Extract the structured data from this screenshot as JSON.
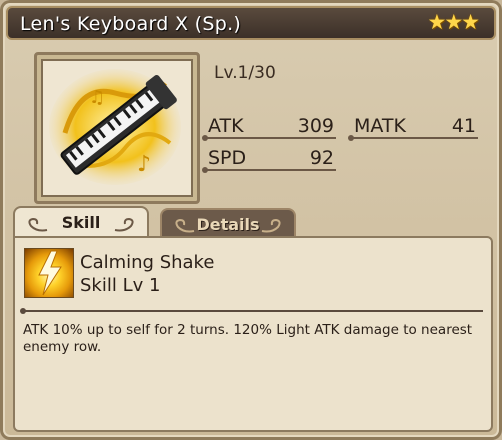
{
  "item": {
    "name": "Len's Keyboard X (Sp.)",
    "rarity_stars": "★★★",
    "level": "Lv.1/30"
  },
  "stats": {
    "atk_label": "ATK",
    "atk_value": "309",
    "matk_label": "MATK",
    "matk_value": "41",
    "spd_label": "SPD",
    "spd_value": "92"
  },
  "tabs": {
    "skill_label": "Skill",
    "details_label": "Details"
  },
  "skill": {
    "name": "Calming Shake",
    "level": "Skill Lv 1",
    "description": "ATK 10% up to self for 2 turns. 120% Light ATK damage to nearest enemy row."
  },
  "colors": {
    "header_bg": "#3c3028",
    "panel_bg": "#ece2cc",
    "star_color": "#ffd64a"
  },
  "icons": [
    "keyboard-weapon-icon",
    "lightning-skill-icon",
    "swirl-ornament-icon"
  ]
}
